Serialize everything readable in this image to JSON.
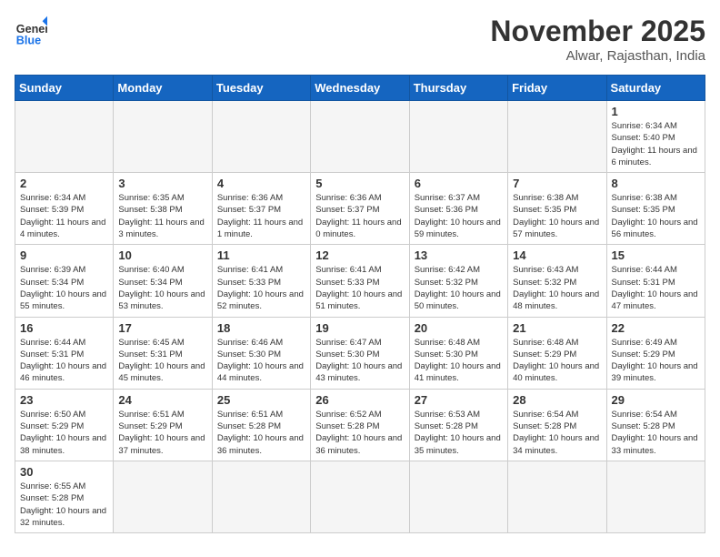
{
  "header": {
    "logo_general": "General",
    "logo_blue": "Blue",
    "month_title": "November 2025",
    "location": "Alwar, Rajasthan, India"
  },
  "days_of_week": [
    "Sunday",
    "Monday",
    "Tuesday",
    "Wednesday",
    "Thursday",
    "Friday",
    "Saturday"
  ],
  "weeks": [
    [
      {
        "day": "",
        "info": ""
      },
      {
        "day": "",
        "info": ""
      },
      {
        "day": "",
        "info": ""
      },
      {
        "day": "",
        "info": ""
      },
      {
        "day": "",
        "info": ""
      },
      {
        "day": "",
        "info": ""
      },
      {
        "day": "1",
        "info": "Sunrise: 6:34 AM\nSunset: 5:40 PM\nDaylight: 11 hours and 6 minutes."
      }
    ],
    [
      {
        "day": "2",
        "info": "Sunrise: 6:34 AM\nSunset: 5:39 PM\nDaylight: 11 hours and 4 minutes."
      },
      {
        "day": "3",
        "info": "Sunrise: 6:35 AM\nSunset: 5:38 PM\nDaylight: 11 hours and 3 minutes."
      },
      {
        "day": "4",
        "info": "Sunrise: 6:36 AM\nSunset: 5:37 PM\nDaylight: 11 hours and 1 minute."
      },
      {
        "day": "5",
        "info": "Sunrise: 6:36 AM\nSunset: 5:37 PM\nDaylight: 11 hours and 0 minutes."
      },
      {
        "day": "6",
        "info": "Sunrise: 6:37 AM\nSunset: 5:36 PM\nDaylight: 10 hours and 59 minutes."
      },
      {
        "day": "7",
        "info": "Sunrise: 6:38 AM\nSunset: 5:35 PM\nDaylight: 10 hours and 57 minutes."
      },
      {
        "day": "8",
        "info": "Sunrise: 6:38 AM\nSunset: 5:35 PM\nDaylight: 10 hours and 56 minutes."
      }
    ],
    [
      {
        "day": "9",
        "info": "Sunrise: 6:39 AM\nSunset: 5:34 PM\nDaylight: 10 hours and 55 minutes."
      },
      {
        "day": "10",
        "info": "Sunrise: 6:40 AM\nSunset: 5:34 PM\nDaylight: 10 hours and 53 minutes."
      },
      {
        "day": "11",
        "info": "Sunrise: 6:41 AM\nSunset: 5:33 PM\nDaylight: 10 hours and 52 minutes."
      },
      {
        "day": "12",
        "info": "Sunrise: 6:41 AM\nSunset: 5:33 PM\nDaylight: 10 hours and 51 minutes."
      },
      {
        "day": "13",
        "info": "Sunrise: 6:42 AM\nSunset: 5:32 PM\nDaylight: 10 hours and 50 minutes."
      },
      {
        "day": "14",
        "info": "Sunrise: 6:43 AM\nSunset: 5:32 PM\nDaylight: 10 hours and 48 minutes."
      },
      {
        "day": "15",
        "info": "Sunrise: 6:44 AM\nSunset: 5:31 PM\nDaylight: 10 hours and 47 minutes."
      }
    ],
    [
      {
        "day": "16",
        "info": "Sunrise: 6:44 AM\nSunset: 5:31 PM\nDaylight: 10 hours and 46 minutes."
      },
      {
        "day": "17",
        "info": "Sunrise: 6:45 AM\nSunset: 5:31 PM\nDaylight: 10 hours and 45 minutes."
      },
      {
        "day": "18",
        "info": "Sunrise: 6:46 AM\nSunset: 5:30 PM\nDaylight: 10 hours and 44 minutes."
      },
      {
        "day": "19",
        "info": "Sunrise: 6:47 AM\nSunset: 5:30 PM\nDaylight: 10 hours and 43 minutes."
      },
      {
        "day": "20",
        "info": "Sunrise: 6:48 AM\nSunset: 5:30 PM\nDaylight: 10 hours and 41 minutes."
      },
      {
        "day": "21",
        "info": "Sunrise: 6:48 AM\nSunset: 5:29 PM\nDaylight: 10 hours and 40 minutes."
      },
      {
        "day": "22",
        "info": "Sunrise: 6:49 AM\nSunset: 5:29 PM\nDaylight: 10 hours and 39 minutes."
      }
    ],
    [
      {
        "day": "23",
        "info": "Sunrise: 6:50 AM\nSunset: 5:29 PM\nDaylight: 10 hours and 38 minutes."
      },
      {
        "day": "24",
        "info": "Sunrise: 6:51 AM\nSunset: 5:29 PM\nDaylight: 10 hours and 37 minutes."
      },
      {
        "day": "25",
        "info": "Sunrise: 6:51 AM\nSunset: 5:28 PM\nDaylight: 10 hours and 36 minutes."
      },
      {
        "day": "26",
        "info": "Sunrise: 6:52 AM\nSunset: 5:28 PM\nDaylight: 10 hours and 36 minutes."
      },
      {
        "day": "27",
        "info": "Sunrise: 6:53 AM\nSunset: 5:28 PM\nDaylight: 10 hours and 35 minutes."
      },
      {
        "day": "28",
        "info": "Sunrise: 6:54 AM\nSunset: 5:28 PM\nDaylight: 10 hours and 34 minutes."
      },
      {
        "day": "29",
        "info": "Sunrise: 6:54 AM\nSunset: 5:28 PM\nDaylight: 10 hours and 33 minutes."
      }
    ],
    [
      {
        "day": "30",
        "info": "Sunrise: 6:55 AM\nSunset: 5:28 PM\nDaylight: 10 hours and 32 minutes."
      },
      {
        "day": "",
        "info": ""
      },
      {
        "day": "",
        "info": ""
      },
      {
        "day": "",
        "info": ""
      },
      {
        "day": "",
        "info": ""
      },
      {
        "day": "",
        "info": ""
      },
      {
        "day": "",
        "info": ""
      }
    ]
  ]
}
